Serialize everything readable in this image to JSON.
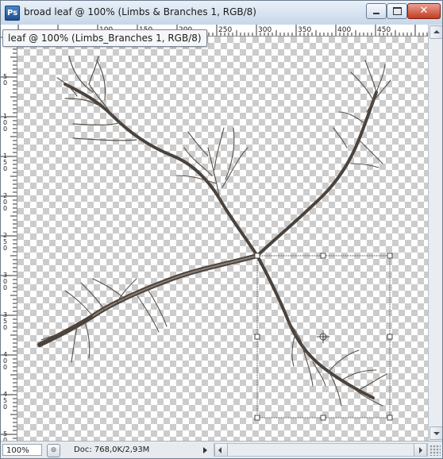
{
  "window": {
    "title": "broad leaf @ 100% (Limbs & Branches 1, RGB/8)",
    "app_icon": "photoshop-doc-icon",
    "app_icon_letter": "Ps",
    "buttons": [
      "minimize-icon",
      "maximize-icon",
      "close-icon"
    ],
    "close_glyph": "✕"
  },
  "tooltip": {
    "text": "leaf @ 100% (Limbs_Branches 1, RGB/8)"
  },
  "rulers": {
    "top_labels": [
      "100",
      "150",
      "200",
      "250",
      "300",
      "350",
      "400",
      "450"
    ],
    "left_labels": [
      "50",
      "100",
      "150",
      "200",
      "250",
      "300",
      "350",
      "400",
      "450",
      "500"
    ]
  },
  "canvas": {
    "content": "bare tree branch artwork on transparent checkerboard",
    "selection": "free-transform bounding box with handles and center pivot"
  },
  "status": {
    "zoom": "100%",
    "doc_info": "Doc: 768,0K/2,93M",
    "icon": "status-options-icon",
    "icon_glyph": "⊚"
  },
  "colors": {
    "branch": "#5a5048",
    "checker_dark": "#cccccc",
    "checker_light": "#ffffff",
    "selection_handles": "#555555"
  }
}
